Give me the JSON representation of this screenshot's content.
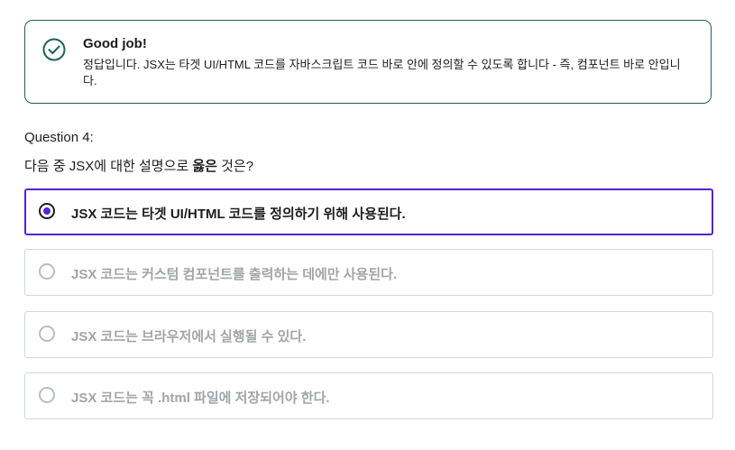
{
  "feedback": {
    "icon": "check-circle-icon",
    "title": "Good job!",
    "text": "정답입니다. JSX는 타겟 UI/HTML 코드를 자바스크립트 코드 바로 안에 정의할 수 있도록 합니다 - 즉, 컴포넌트 바로 안입니다.",
    "accent_color": "#1e6055"
  },
  "question": {
    "number_label": "Question 4:",
    "prompt_before": "다음 중 JSX에 대한 설명으로 ",
    "prompt_bold": "옳은",
    "prompt_after": " 것은?"
  },
  "options": [
    {
      "label": "JSX 코드는 타겟 UI/HTML 코드를 정의하기 위해 사용된다.",
      "selected": true
    },
    {
      "label": "JSX 코드는 커스텀 컴포넌트를 출력하는 데에만 사용된다.",
      "selected": false
    },
    {
      "label": "JSX 코드는 브라우저에서 실행될 수 있다.",
      "selected": false
    },
    {
      "label": "JSX 코드는 꼭 .html 파일에 저장되어야 한다.",
      "selected": false
    }
  ],
  "colors": {
    "selected_accent": "#5624d0",
    "disabled_text": "#a1a5a9",
    "border": "#d1d7dc"
  }
}
